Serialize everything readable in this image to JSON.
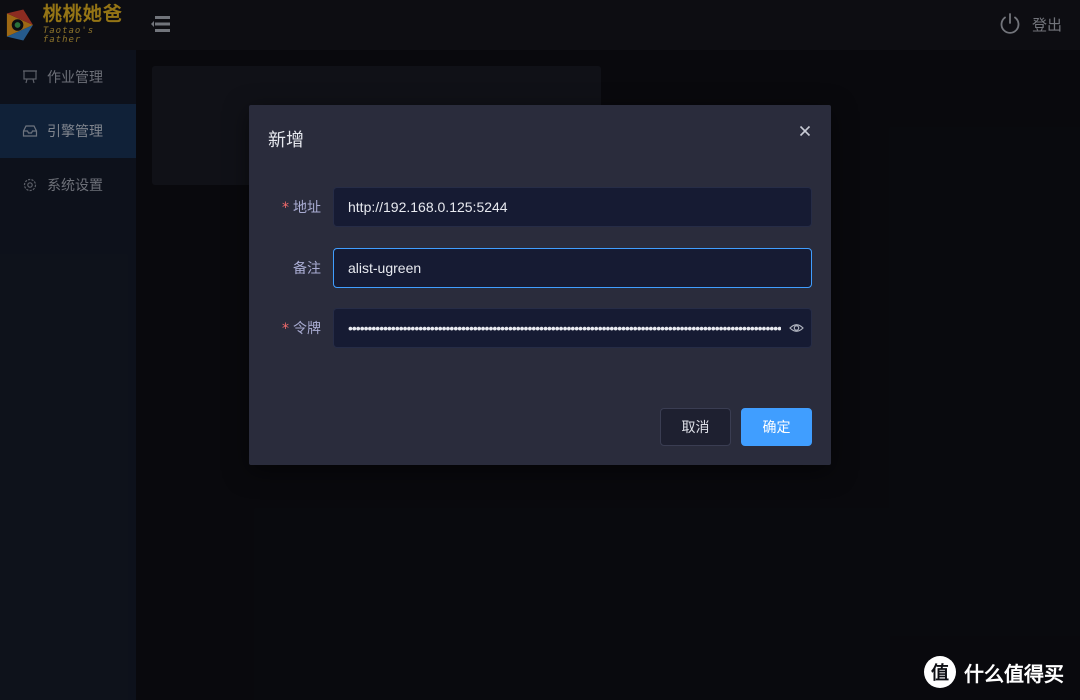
{
  "header": {
    "logo_cn": "桃桃她爸",
    "logo_en": "Taotao's father",
    "logout_label": "登出"
  },
  "sidebar": {
    "items": [
      {
        "label": "作业管理",
        "icon": "presentation-board-icon",
        "active": false
      },
      {
        "label": "引擎管理",
        "icon": "inbox-tray-icon",
        "active": true
      },
      {
        "label": "系统设置",
        "icon": "gear-icon",
        "active": false
      }
    ]
  },
  "dialog": {
    "title": "新增",
    "fields": {
      "address": {
        "label": "地址",
        "required": true,
        "value": "http://192.168.0.125:5244"
      },
      "remark": {
        "label": "备注",
        "required": false,
        "value": "alist-ugreen"
      },
      "token": {
        "label": "令牌",
        "required": true,
        "value": "••••••••••••••••••••••••••••••••••••••••••••••••••••••••••••••••••••••••••••••••••••••••••••••••••••••••••••••••••••••"
      }
    },
    "cancel_label": "取消",
    "ok_label": "确定"
  },
  "watermark": {
    "glyph": "值",
    "text": "什么值得买"
  },
  "colors": {
    "accent": "#409eff",
    "required": "#f56c6c",
    "logo_gold": "#e3b321"
  }
}
